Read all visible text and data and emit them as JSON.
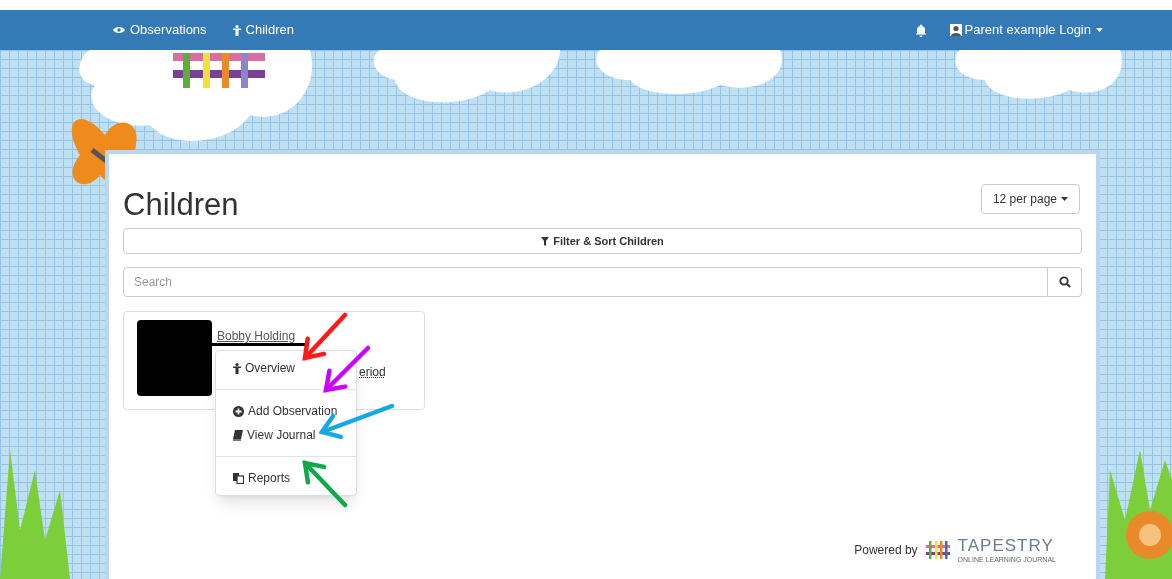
{
  "navbar": {
    "links": [
      {
        "label": "Observations"
      },
      {
        "label": "Children"
      }
    ],
    "user": "Parent example Login"
  },
  "page": {
    "title": "Children",
    "per_page": "12 per page",
    "filter": "Filter & Sort Children",
    "search": {
      "placeholder": "Search"
    }
  },
  "child_card": {
    "name": "Bobby Holding",
    "partial_link": "eriod"
  },
  "menu": {
    "items": [
      {
        "kind": "item",
        "label": "Overview"
      },
      {
        "kind": "divider"
      },
      {
        "kind": "item",
        "label": "Add Observation"
      },
      {
        "kind": "item",
        "label": "View Journal"
      },
      {
        "kind": "divider"
      },
      {
        "kind": "item",
        "label": "Reports"
      }
    ]
  },
  "annotations": [
    {
      "kind": "arrow",
      "color": "#ff1a1a"
    },
    {
      "kind": "arrow",
      "color": "#cc00ff"
    },
    {
      "kind": "arrow",
      "color": "#14a9e6"
    },
    {
      "kind": "arrow",
      "color": "#10a84a"
    }
  ],
  "footer": {
    "powered_by": "Powered by",
    "logo": "TAPESTRY",
    "tagline": "ONLINE LEARNING JOURNAL"
  }
}
